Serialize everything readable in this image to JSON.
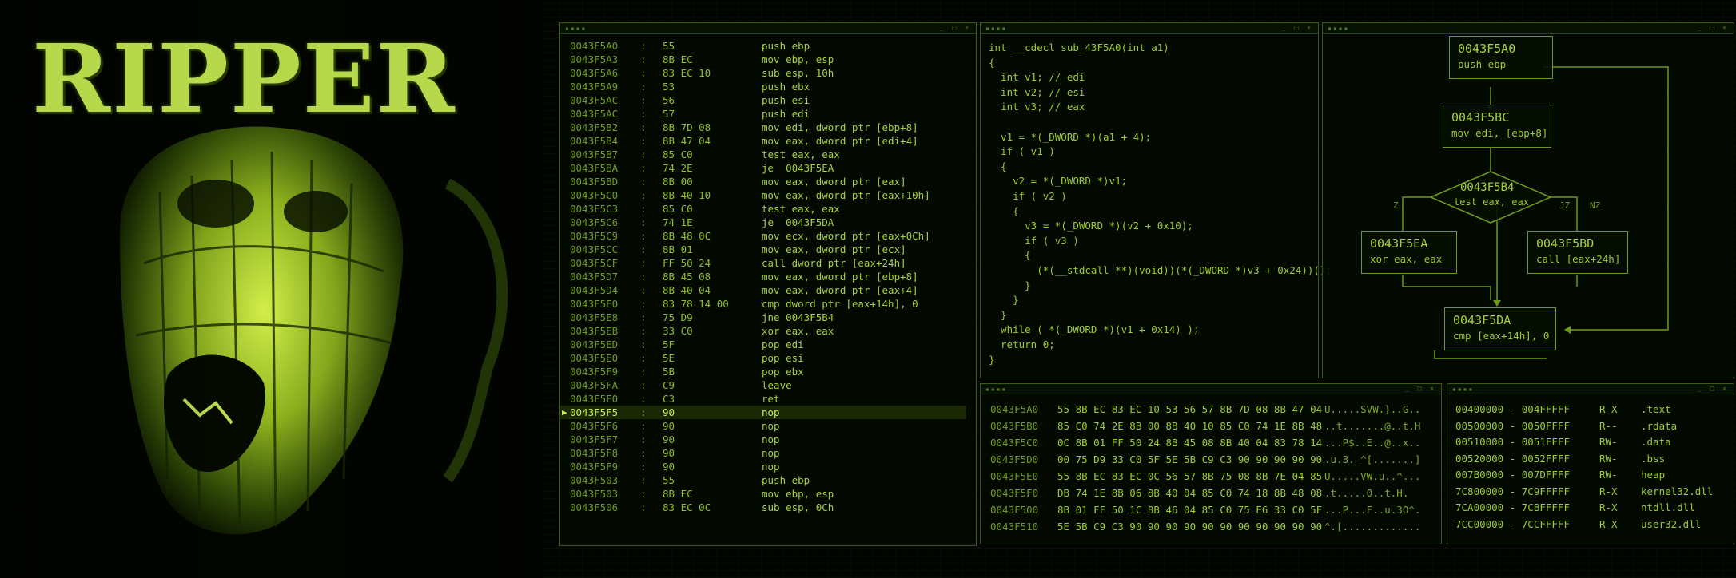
{
  "poster": {
    "title": "RIPPER"
  },
  "disasm": {
    "rows": [
      {
        "addr": "0043F5A0",
        "bytes": "55",
        "mnem": "push ebp"
      },
      {
        "addr": "0043F5A3",
        "bytes": "8B EC",
        "mnem": "mov ebp, esp"
      },
      {
        "addr": "0043F5A6",
        "bytes": "83 EC 10",
        "mnem": "sub esp, 10h"
      },
      {
        "addr": "0043F5A9",
        "bytes": "53",
        "mnem": "push ebx"
      },
      {
        "addr": "0043F5AC",
        "bytes": "56",
        "mnem": "push esi"
      },
      {
        "addr": "0043F5AC",
        "bytes": "57",
        "mnem": "push edi"
      },
      {
        "addr": "0043F5B2",
        "bytes": "8B 7D 08",
        "mnem": "mov edi, dword ptr [ebp+8]"
      },
      {
        "addr": "0043F5B4",
        "bytes": "8B 47 04",
        "mnem": "mov eax, dword ptr [edi+4]"
      },
      {
        "addr": "0043F5B7",
        "bytes": "85 C0",
        "mnem": "test eax, eax"
      },
      {
        "addr": "0043F5BA",
        "bytes": "74 2E",
        "mnem": "je  0043F5EA"
      },
      {
        "addr": "0043F5BD",
        "bytes": "8B 00",
        "mnem": "mov eax, dword ptr [eax]"
      },
      {
        "addr": "0043F5C0",
        "bytes": "8B 40 10",
        "mnem": "mov eax, dword ptr [eax+10h]"
      },
      {
        "addr": "0043F5C3",
        "bytes": "85 C0",
        "mnem": "test eax, eax"
      },
      {
        "addr": "0043F5C6",
        "bytes": "74 1E",
        "mnem": "je  0043F5DA"
      },
      {
        "addr": "0043F5C9",
        "bytes": "8B 48 0C",
        "mnem": "mov ecx, dword ptr [eax+0Ch]"
      },
      {
        "addr": "0043F5CC",
        "bytes": "8B 01",
        "mnem": "mov eax, dword ptr [ecx]"
      },
      {
        "addr": "0043F5CF",
        "bytes": "FF 50 24",
        "mnem": "call dword ptr [eax+24h]"
      },
      {
        "addr": "0043F5D7",
        "bytes": "8B 45 08",
        "mnem": "mov eax, dword ptr [ebp+8]"
      },
      {
        "addr": "0043F5D4",
        "bytes": "8B 40 04",
        "mnem": "mov eax, dword ptr [eax+4]"
      },
      {
        "addr": "0043F5E0",
        "bytes": "83 78 14 00",
        "mnem": "cmp dword ptr [eax+14h], 0"
      },
      {
        "addr": "0043F5E8",
        "bytes": "75 D9",
        "mnem": "jne 0043F5B4"
      },
      {
        "addr": "0043F5EB",
        "bytes": "33 C0",
        "mnem": "xor eax, eax"
      },
      {
        "addr": "0043F5ED",
        "bytes": "5F",
        "mnem": "pop edi"
      },
      {
        "addr": "0043F5E0",
        "bytes": "5E",
        "mnem": "pop esi"
      },
      {
        "addr": "0043F5F9",
        "bytes": "5B",
        "mnem": "pop ebx"
      },
      {
        "addr": "0043F5FA",
        "bytes": "C9",
        "mnem": "leave"
      },
      {
        "addr": "0043F5F0",
        "bytes": "C3",
        "mnem": "ret"
      },
      {
        "addr": "0043F5F5",
        "bytes": "90",
        "mnem": "nop",
        "highlight": true
      },
      {
        "addr": "0043F5F6",
        "bytes": "90",
        "mnem": "nop"
      },
      {
        "addr": "0043F5F7",
        "bytes": "90",
        "mnem": "nop"
      },
      {
        "addr": "0043F5F8",
        "bytes": "90",
        "mnem": "nop"
      },
      {
        "addr": "0043F5F9",
        "bytes": "90",
        "mnem": "nop"
      },
      {
        "addr": "0043F503",
        "bytes": "55",
        "mnem": "push ebp"
      },
      {
        "addr": "0043F503",
        "bytes": "8B EC",
        "mnem": "mov ebp, esp"
      },
      {
        "addr": "0043F506",
        "bytes": "83 EC 0C",
        "mnem": "sub esp, 0Ch"
      }
    ]
  },
  "pseudocode": {
    "lines": [
      "int __cdecl sub_43F5A0(int a1)",
      "{",
      "  int v1; // edi",
      "  int v2; // esi",
      "  int v3; // eax",
      "",
      "  v1 = *(_DWORD *)(a1 + 4);",
      "  if ( v1 )",
      "  {",
      "    v2 = *(_DWORD *)v1;",
      "    if ( v2 )",
      "    {",
      "      v3 = *(_DWORD *)(v2 + 0x10);",
      "      if ( v3 )",
      "      {",
      "        (*(__stdcall **)(void))(*(_DWORD *)v3 + 0x24))();",
      "      }",
      "    }",
      "  }",
      "  while ( *(_DWORD *)(v1 + 0x14) );",
      "  return 0;",
      "}"
    ]
  },
  "graph": {
    "nodes": [
      {
        "addr": "0043F5A0",
        "instr": "push  ebp"
      },
      {
        "addr": "0043F5BC",
        "instr": "mov edi, [ebp+8]"
      },
      {
        "addr": "0043F5B4",
        "instr": "test eax, eax"
      },
      {
        "addr": "0043F5EA",
        "instr": "xor eax, eax"
      },
      {
        "addr": "0043F5BD",
        "instr": "call [eax+24h]"
      },
      {
        "addr": "0043F5DA",
        "instr": "cmp [eax+14h], 0"
      }
    ],
    "edge_labels": {
      "left": "Z",
      "right_a": "JZ",
      "right_b": "NZ"
    }
  },
  "hexdump": {
    "rows": [
      {
        "addr": "0043F5A0",
        "hex": "55 8B EC 83 EC 10 53 56 57 8B 7D 08 8B 47 04",
        "ascii": "U.....SVW.}..G.."
      },
      {
        "addr": "0043F5B0",
        "hex": "85 C0 74 2E 8B 00 8B 40 10 85 C0 74 1E 8B 48",
        "ascii": "..t.......@..t.H"
      },
      {
        "addr": "0043F5C0",
        "hex": "0C 8B 01 FF 50 24 8B 45 08 8B 40 04 83 78 14",
        "ascii": "...P$..E..@..x.."
      },
      {
        "addr": "0043F5D0",
        "hex": "00 75 D9 33 C0 5F 5E 5B C9 C3 90 90 90 90 90",
        "ascii": ".u.3._^[.......]"
      },
      {
        "addr": "0043F5E0",
        "hex": "55 8B EC 83 EC 0C 56 57 8B 75 08 8B 7E 04 85",
        "ascii": "U.....VW.u..^..."
      },
      {
        "addr": "0043F5F0",
        "hex": "DB 74 1E 8B 06 8B 40 04 85 C0 74 18 8B 48 08",
        "ascii": ".t.....0..t.H."
      },
      {
        "addr": "0043F500",
        "hex": "8B 01 FF 50 1C 8B 46 04 85 C0 75 E6 33 C0 5F",
        "ascii": "...P...F..u.3O^."
      },
      {
        "addr": "0043F510",
        "hex": "5E 5B C9 C3 90 90 90 90 90 90 90 90 90 90 90",
        "ascii": "^.[............."
      }
    ]
  },
  "segments": {
    "rows": [
      {
        "range": "00400000 - 004FFFFF",
        "perm": "R-X",
        "name": ".text"
      },
      {
        "range": "00500000 - 0050FFFF",
        "perm": "R--",
        "name": ".rdata"
      },
      {
        "range": "00510000 - 0051FFFF",
        "perm": "RW-",
        "name": ".data"
      },
      {
        "range": "00520000 - 0052FFFF",
        "perm": "RW-",
        "name": ".bss"
      },
      {
        "range": "007B0000 - 007DFFFF",
        "perm": "RW-",
        "name": "heap"
      },
      {
        "range": "7C800000 - 7C9FFFFF",
        "perm": "R-X",
        "name": "kernel32.dll"
      },
      {
        "range": "7CA00000 - 7CBFFFFF",
        "perm": "R-X",
        "name": "ntdll.dll"
      },
      {
        "range": "7CC00000 - 7CCFFFFF",
        "perm": "R-X",
        "name": "user32.dll"
      }
    ]
  },
  "colors": {
    "accent": "#a6d13a",
    "dim": "#6f9a22",
    "border": "#3b5a12",
    "background": "#020400"
  }
}
